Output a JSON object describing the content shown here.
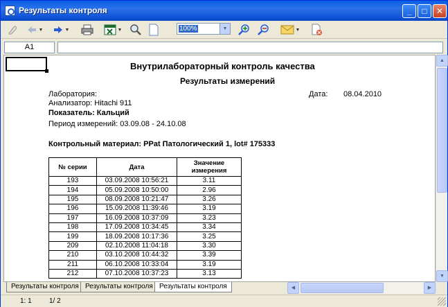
{
  "window": {
    "title": "Результаты контроля"
  },
  "titlebar_buttons": {
    "minimize": "_",
    "maximize": "□",
    "close": "✕"
  },
  "toolbar": {
    "zoom_value": "100%"
  },
  "formula_bar": {
    "cell_ref": "A1",
    "formula": ""
  },
  "report": {
    "title": "Внутрилабораторный контроль качества",
    "subtitle": "Результаты измерений",
    "lab_label": "Лаборатория:",
    "date_label": "Дата:",
    "date_value": "08.04.2010",
    "analyzer": "Анализатор: Hitachi 911",
    "indicator": "Показатель: Кальций",
    "period": "Период измерений: 03.09.08 - 24.10.08",
    "control_material": "Контрольный материал: PPat Патологический 1, lot# 175333"
  },
  "table": {
    "headers": [
      "№ серии",
      "Дата",
      "Значение измерения"
    ],
    "rows": [
      [
        "193",
        "03.09.2008 10:56:21",
        "3.11"
      ],
      [
        "194",
        "05.09.2008 10:50:00",
        "2.96"
      ],
      [
        "195",
        "08.09.2008 10:21:47",
        "3.26"
      ],
      [
        "196",
        "15.09.2008 11:39:46",
        "3.19"
      ],
      [
        "197",
        "16.09.2008 10:37:09",
        "3.23"
      ],
      [
        "198",
        "17.09.2008 10:34:45",
        "3.34"
      ],
      [
        "199",
        "18.09.2008 10:17:36",
        "3.25"
      ],
      [
        "209",
        "02.10.2008 11:04:18",
        "3.30"
      ],
      [
        "210",
        "03.10.2008 10:44:32",
        "3.39"
      ],
      [
        "211",
        "06.10.2008 10:33:04",
        "3.19"
      ],
      [
        "212",
        "07.10.2008 10:37:23",
        "3.13"
      ]
    ]
  },
  "sheet_tabs": [
    "Результаты контроля",
    "Результаты контроля",
    "Результаты контроля"
  ],
  "status": {
    "position": "1: 1",
    "pages": "1/ 2"
  }
}
